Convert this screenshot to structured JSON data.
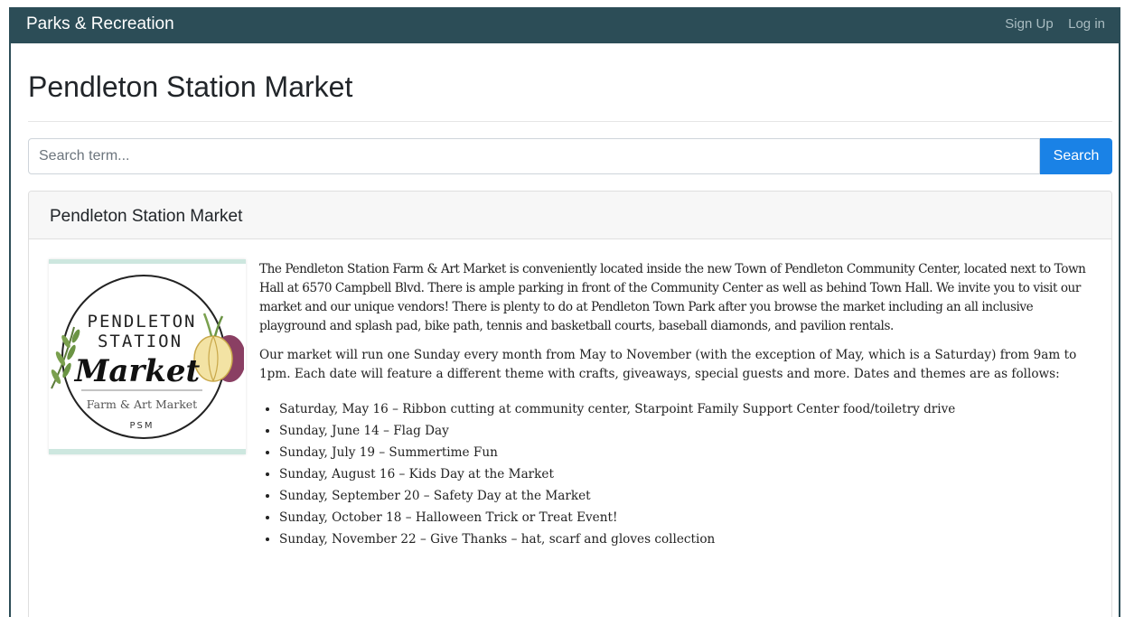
{
  "navbar": {
    "brand": "Parks & Recreation",
    "links": [
      "Sign Up",
      "Log in"
    ]
  },
  "page": {
    "title": "Pendleton Station Market"
  },
  "search": {
    "placeholder": "Search term...",
    "value": "",
    "button_label": "Search"
  },
  "card": {
    "title": "Pendleton Station Market",
    "logo": {
      "line1": "PENDLETON",
      "line2": "STATION",
      "line3": "Market",
      "line4": "Farm & Art Market",
      "line5": "PSM"
    },
    "paragraphs": [
      "The Pendleton Station Farm & Art Market is conveniently located inside the new Town of Pendleton Community Center, located next to Town Hall at 6570 Campbell Blvd. There is ample parking in front of the Community Center as well as behind Town Hall. We invite you to visit our market and our unique vendors! There is plenty to do at Pendleton Town Park after you browse the market including an all inclusive playground and splash pad, bike path, tennis and basketball courts, baseball diamonds, and pavilion rentals.",
      "Our market will run one Sunday every month from May to November (with the exception of May, which is a Saturday) from 9am to 1pm. Each date will feature a different theme with crafts, giveaways, special guests and more. Dates and themes are as follows:"
    ],
    "events": [
      "Saturday, May 16 – Ribbon cutting at community center, Starpoint Family Support Center food/toiletry drive",
      "Sunday, June 14 – Flag Day",
      "Sunday, July 19 – Summertime Fun",
      "Sunday, August 16 – Kids Day at the Market",
      "Sunday, September 20 – Safety Day at the Market",
      "Sunday, October 18 – Halloween Trick or Treat Event!",
      "Sunday, November 22 – Give Thanks – hat, scarf and gloves collection"
    ]
  },
  "colors": {
    "navbar": "#2c4d57",
    "accent": "#1a82e6",
    "logo_border": "#cde7df"
  }
}
